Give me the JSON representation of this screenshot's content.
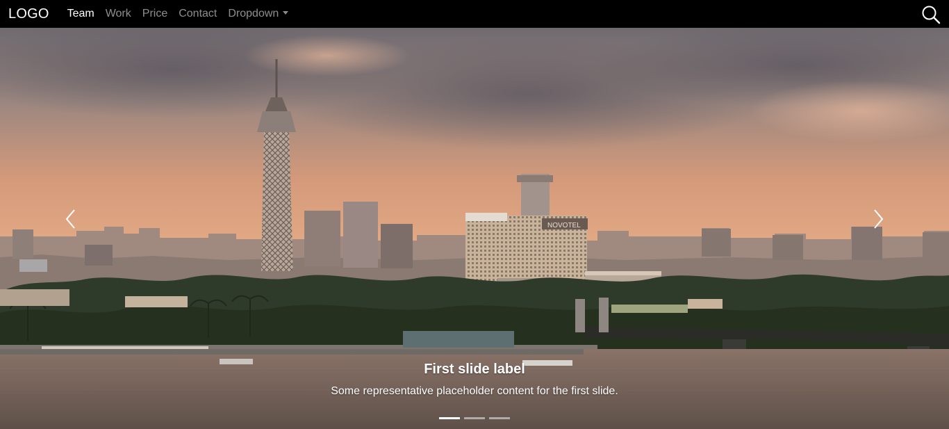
{
  "navbar": {
    "brand": "LOGO",
    "links": [
      {
        "label": "Team",
        "active": true
      },
      {
        "label": "Work",
        "active": false
      },
      {
        "label": "Price",
        "active": false
      },
      {
        "label": "Contact",
        "active": false
      }
    ],
    "dropdown_label": "Dropdown",
    "search_icon": "search-icon"
  },
  "carousel": {
    "caption_title": "First slide label",
    "caption_text": "Some representative placeholder content for the first slide.",
    "slide_count": 3,
    "active_index": 0,
    "prev_icon": "chevron-left-icon",
    "next_icon": "chevron-right-icon"
  },
  "colors": {
    "navbar_bg": "#000000",
    "sky_top": "#6f6a70",
    "sky_glow": "#e3a37c",
    "river": "#6e5d55"
  }
}
